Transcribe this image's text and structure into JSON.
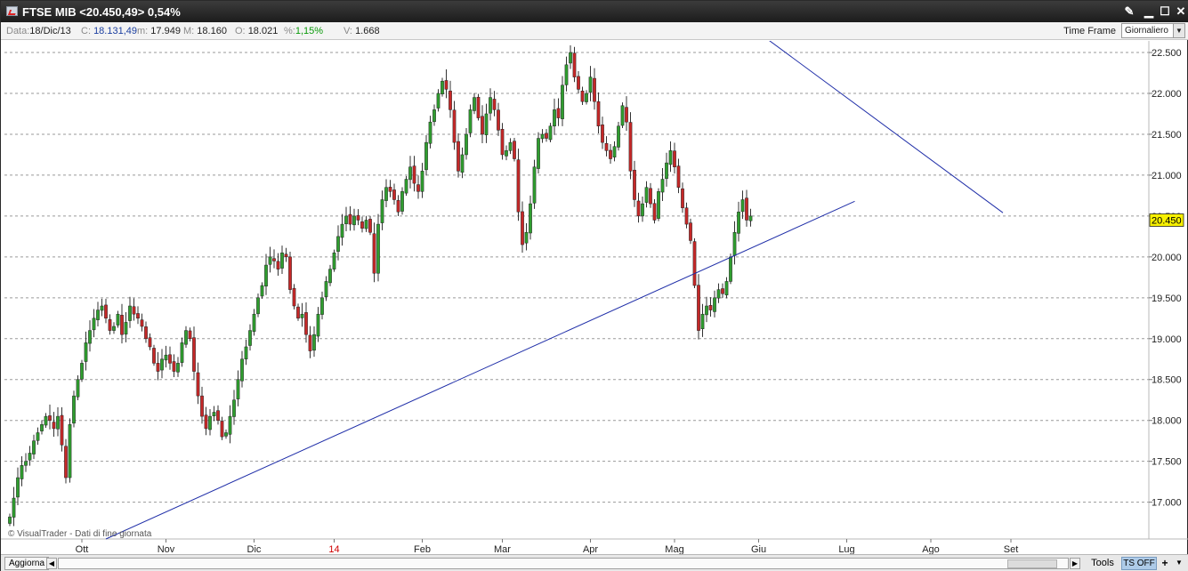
{
  "window": {
    "title": "FTSE MIB <20.450,49> 0,54%",
    "controls": {
      "tools": "✎",
      "minimize": "▁",
      "maximize": "☐",
      "close": "✕"
    }
  },
  "info": {
    "data_label": "Data:",
    "data_value": "18/Dic/13",
    "close_label": "C:",
    "close_value": "18.131,49",
    "min_label": "m:",
    "min_value": "17.949",
    "max_label": "M:",
    "max_value": "18.160",
    "open_label": "O:",
    "open_value": "18.021",
    "pct_label": "%:",
    "pct_value": "1,15%",
    "vol_label": "V:",
    "vol_value": "1.668",
    "timeframe_label": "Time Frame",
    "timeframe_value": "Giornaliero"
  },
  "watermark": "© VisualTrader - Dati di fine giornata",
  "bottom": {
    "aggiorna": "Aggiorna",
    "tools": "Tools",
    "ts_off": "TS OFF",
    "plus": "+",
    "more": "▼"
  },
  "colors": {
    "up": "#2f9e2f",
    "down": "#c62828",
    "trendline": "#1f2ea8",
    "last_price_bg": "#f7f000",
    "last_month": "#d00000"
  },
  "chart_data": {
    "type": "candlestick",
    "y_ticks": [
      17000,
      17500,
      18000,
      18500,
      19000,
      19500,
      20000,
      20500,
      21000,
      21500,
      22000,
      22500
    ],
    "y_tick_labels": [
      "17.000",
      "17.500",
      "18.000",
      "18.500",
      "19.000",
      "19.500",
      "20.000",
      "20.500",
      "21.000",
      "21.500",
      "22.000",
      "22.500"
    ],
    "ylim": [
      16550,
      22620
    ],
    "x_labels": [
      "Ott",
      "Nov",
      "Dic",
      "14",
      "Feb",
      "Mar",
      "Apr",
      "Mag",
      "Giu",
      "Lug",
      "Ago",
      "Set"
    ],
    "x_label_positions": [
      18,
      39,
      61,
      81,
      103,
      123,
      145,
      166,
      187,
      209,
      230,
      250
    ],
    "highlight_label": "14",
    "last_price": 20450,
    "last_price_label": "20.450",
    "trendlines": [
      {
        "from": [
          24,
          16550
        ],
        "to": [
          211,
          20680
        ]
      },
      {
        "from": [
          189,
          22670
        ],
        "to": [
          248,
          20540
        ]
      }
    ],
    "closes": [
      16820,
      17050,
      17300,
      17450,
      17500,
      17600,
      17750,
      17850,
      17950,
      18050,
      18000,
      17900,
      18050,
      17700,
      17300,
      17950,
      18300,
      18500,
      18700,
      18950,
      19100,
      19250,
      19350,
      19400,
      19250,
      19100,
      19150,
      19300,
      19050,
      19200,
      19400,
      19300,
      19250,
      19150,
      19000,
      18900,
      18700,
      18600,
      18750,
      18800,
      18700,
      18600,
      18700,
      18950,
      19100,
      19000,
      18600,
      18300,
      18050,
      17900,
      18050,
      18100,
      18000,
      17800,
      17850,
      18050,
      18250,
      18500,
      18750,
      18900,
      19100,
      19300,
      19500,
      19650,
      19900,
      20000,
      19950,
      19850,
      20050,
      20000,
      19600,
      19400,
      19250,
      19300,
      19050,
      18850,
      19050,
      19300,
      19500,
      19700,
      19850,
      20050,
      20250,
      20400,
      20500,
      20400,
      20500,
      20450,
      20350,
      20450,
      20300,
      19800,
      20400,
      20700,
      20850,
      20800,
      20700,
      20550,
      20800,
      20950,
      21100,
      20900,
      20800,
      21050,
      21400,
      21650,
      21800,
      22000,
      22150,
      22050,
      21800,
      21400,
      21050,
      21250,
      21500,
      21800,
      21950,
      21700,
      21500,
      21750,
      21950,
      21800,
      21550,
      21250,
      21300,
      21400,
      21200,
      20550,
      20150,
      20300,
      20650,
      21100,
      21450,
      21500,
      21450,
      21600,
      21800,
      21700,
      22100,
      22350,
      22500,
      22200,
      22050,
      21900,
      22000,
      22200,
      21900,
      21600,
      21400,
      21300,
      21200,
      21350,
      21600,
      21850,
      21650,
      21050,
      20700,
      20500,
      20650,
      20850,
      20650,
      20450,
      20800,
      20950,
      21150,
      21300,
      21100,
      20850,
      20600,
      20400,
      20200,
      19650,
      19100,
      19300,
      19400,
      19350,
      19500,
      19600,
      19550,
      19700,
      20000,
      20300,
      20550,
      20700,
      20450,
      20500
    ]
  }
}
